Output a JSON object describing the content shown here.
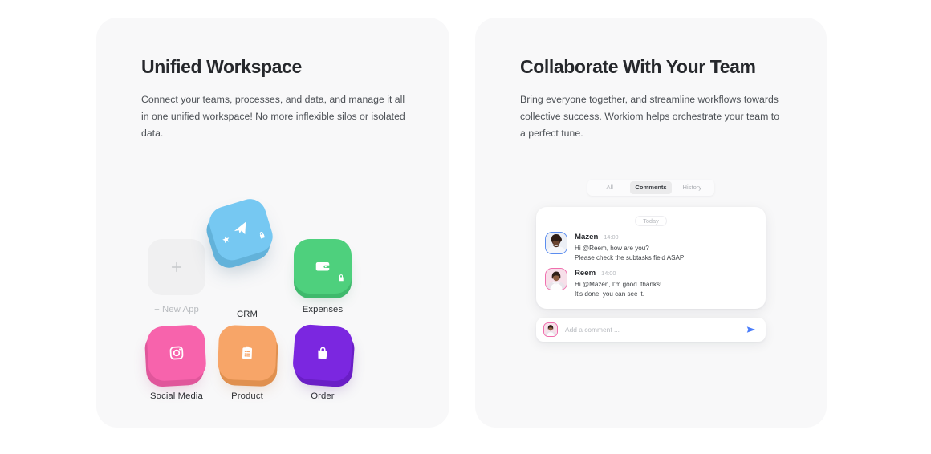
{
  "colors": {
    "page_bg": "#ffffff",
    "card_bg": "#f8f8f9",
    "heading": "#26282c",
    "body_text": "#4d5156",
    "tile_crm": "#76c8f2",
    "tile_expenses": "#4ed07d",
    "tile_social": "#f763ac",
    "tile_product": "#f7a568",
    "tile_order": "#7b27e0",
    "tile_new_app": "#f0f0f1",
    "accent_send": "#4a7dfb",
    "avatar_border_blue": "#5b8def",
    "avatar_border_pink": "#f06fae"
  },
  "left_card": {
    "heading": "Unified Workspace",
    "body": "Connect your teams, processes, and data, and manage it all in one unified workspace! No more inflexible silos or isolated data.",
    "apps": [
      {
        "label": "+ New App",
        "icon": "plus-icon",
        "muted": true,
        "locked": false
      },
      {
        "label": "CRM",
        "icon": "paper-plane-icon",
        "muted": false,
        "locked": true
      },
      {
        "label": "Expenses",
        "icon": "wallet-icon",
        "muted": false,
        "locked": true
      },
      {
        "label": "Social Media",
        "icon": "camera-icon",
        "muted": false,
        "locked": false
      },
      {
        "label": "Product",
        "icon": "clipboard-list-icon",
        "muted": false,
        "locked": false
      },
      {
        "label": "Order",
        "icon": "shopping-bag-icon",
        "muted": false,
        "locked": false
      }
    ]
  },
  "right_card": {
    "heading": "Collaborate With Your Team",
    "body": "Bring everyone together, and streamline workflows towards collective success. Workiom helps orchestrate your team to a perfect tune.",
    "chat": {
      "tabs": [
        {
          "label": "All",
          "active": false
        },
        {
          "label": "Comments",
          "active": true
        },
        {
          "label": "History",
          "active": false
        }
      ],
      "date_divider": "Today",
      "messages": [
        {
          "name": "Mazen",
          "time": "14:00",
          "avatar": "avatar-mazen",
          "avatar_border": "blue",
          "lines": [
            "Hi @Reem, how are you?",
            "Please check the subtasks field ASAP!"
          ]
        },
        {
          "name": "Reem",
          "time": "14:00",
          "avatar": "avatar-reem",
          "avatar_border": "pink",
          "lines": [
            "Hi @Mazen, I'm good. thanks!",
            "It's done, you can see it."
          ]
        }
      ],
      "composer": {
        "placeholder": "Add a comment ...",
        "value": "",
        "avatar": "avatar-reem",
        "send_icon": "send-icon"
      }
    }
  }
}
